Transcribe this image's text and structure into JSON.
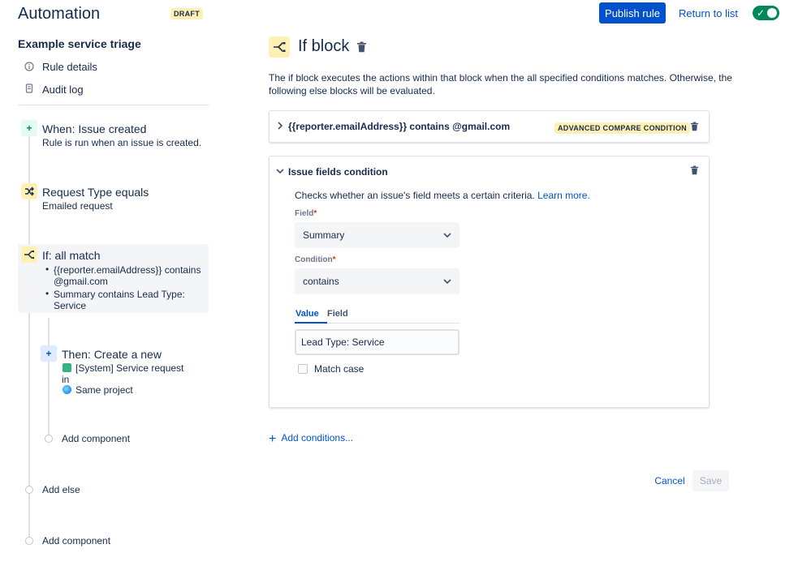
{
  "header": {
    "app_title": "Automation",
    "draft_badge": "DRAFT",
    "publish_label": "Publish rule",
    "return_label": "Return to list",
    "toggle_on": true,
    "toggle_color": "#00875a"
  },
  "sidebar": {
    "rule_name": "Example service triage",
    "links": [
      {
        "label": "Rule details",
        "icon": "info-icon"
      },
      {
        "label": "Audit log",
        "icon": "document-icon"
      }
    ],
    "trigger": {
      "title": "When: Issue created",
      "subtitle": "Rule is run when an issue is created.",
      "icon": "plus-icon"
    },
    "condition": {
      "title": "Request Type equals",
      "subtitle": "Emailed request",
      "icon": "shuffle-icon"
    },
    "if_block": {
      "title": "If: all match",
      "items": [
        "{{reporter.emailAddress}} contains @gmail.com",
        "Summary contains Lead Type: Service"
      ],
      "icon": "branch-icon"
    },
    "then_action": {
      "title": "Then: Create a new",
      "line1": "[System] Service request",
      "line2": "in",
      "line3": "Same project",
      "icon": "plus-icon"
    },
    "add_component_inner": "Add component",
    "add_else": "Add else",
    "add_component_outer": "Add component"
  },
  "main": {
    "title": "If block",
    "description": "The if block executes the actions within that block when the all specified conditions matches. Otherwise, the following else blocks will be evaluated.",
    "condition1": {
      "title": "{{reporter.emailAddress}} contains @gmail.com",
      "badge": "ADVANCED COMPARE CONDITION"
    },
    "condition2": {
      "title": "Issue fields condition",
      "help_text": "Checks whether an issue's field meets a certain criteria.",
      "help_link": "Learn more.",
      "field_label": "Field",
      "field_value": "Summary",
      "condition_label": "Condition",
      "condition_value": "contains",
      "tabs": [
        "Value",
        "Field"
      ],
      "value_input": "Lead Type: Service",
      "match_case_label": "Match case"
    },
    "add_conditions": "Add conditions...",
    "cancel_label": "Cancel",
    "save_label": "Save"
  }
}
